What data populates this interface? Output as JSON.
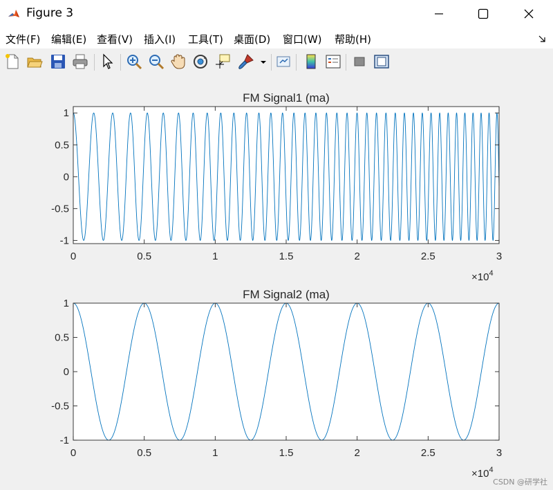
{
  "window": {
    "title": "Figure 3",
    "icon": "matlab-icon",
    "controls": [
      "minimize-icon",
      "maximize-icon",
      "close-icon"
    ]
  },
  "menu": {
    "items": [
      {
        "label": "文件(F)"
      },
      {
        "label": "编辑(E)"
      },
      {
        "label": "查看(V)"
      },
      {
        "label": "插入(I)"
      },
      {
        "label": "工具(T)"
      },
      {
        "label": "桌面(D)"
      },
      {
        "label": "窗口(W)"
      },
      {
        "label": "帮助(H)"
      }
    ]
  },
  "toolbar": {
    "buttons": [
      "new-figure-icon",
      "open-file-icon",
      "save-icon",
      "print-icon",
      "edit-plot-arrow-icon",
      "zoom-in-icon",
      "zoom-out-icon",
      "pan-hand-icon",
      "rotate-3d-icon",
      "data-cursor-icon",
      "brush-icon",
      "brush-dropdown-icon",
      "link-plot-icon",
      "insert-colorbar-icon",
      "insert-legend-icon",
      "hide-plot-tools-icon",
      "show-plot-tools-icon"
    ]
  },
  "colors": {
    "line": "#0072bd",
    "axes_text": "#262626",
    "axes_frame": "#262626",
    "background": "#f0f0f0"
  },
  "chart_data": [
    {
      "type": "line",
      "title": "FM Signal1 (ma)",
      "xlabel": "",
      "ylabel": "",
      "x_exponent": "×10^4",
      "xlim": [
        0,
        30000
      ],
      "ylim": [
        -1.05,
        1.1
      ],
      "xticks": [
        "0",
        "0.5",
        "1",
        "1.5",
        "2",
        "2.5",
        "3"
      ],
      "yticks": [
        "-1",
        "-0.5",
        "0",
        "0.5",
        "1"
      ],
      "grid": false,
      "series": [
        {
          "signal": "chirp",
          "amplitude": 1,
          "phase_deg": 90,
          "start_period": 1500,
          "end_period": 550,
          "x_range": [
            0,
            30000
          ]
        }
      ]
    },
    {
      "type": "line",
      "title": "FM Signal2 (ma)",
      "xlabel": "",
      "ylabel": "",
      "x_exponent": "×10^4",
      "xlim": [
        0,
        30000
      ],
      "ylim": [
        -1,
        1
      ],
      "xticks": [
        "0",
        "0.5",
        "1",
        "1.5",
        "2",
        "2.5",
        "3"
      ],
      "yticks": [
        "-1",
        "-0.5",
        "0",
        "0.5",
        "1"
      ],
      "grid": false,
      "series": [
        {
          "signal": "sinusoid",
          "amplitude": 1,
          "period": 5000,
          "first_peak_x": 5000,
          "value_at_zero": 0.75,
          "x_range": [
            0,
            30000
          ]
        }
      ]
    }
  ],
  "watermark": "CSDN @研学社"
}
